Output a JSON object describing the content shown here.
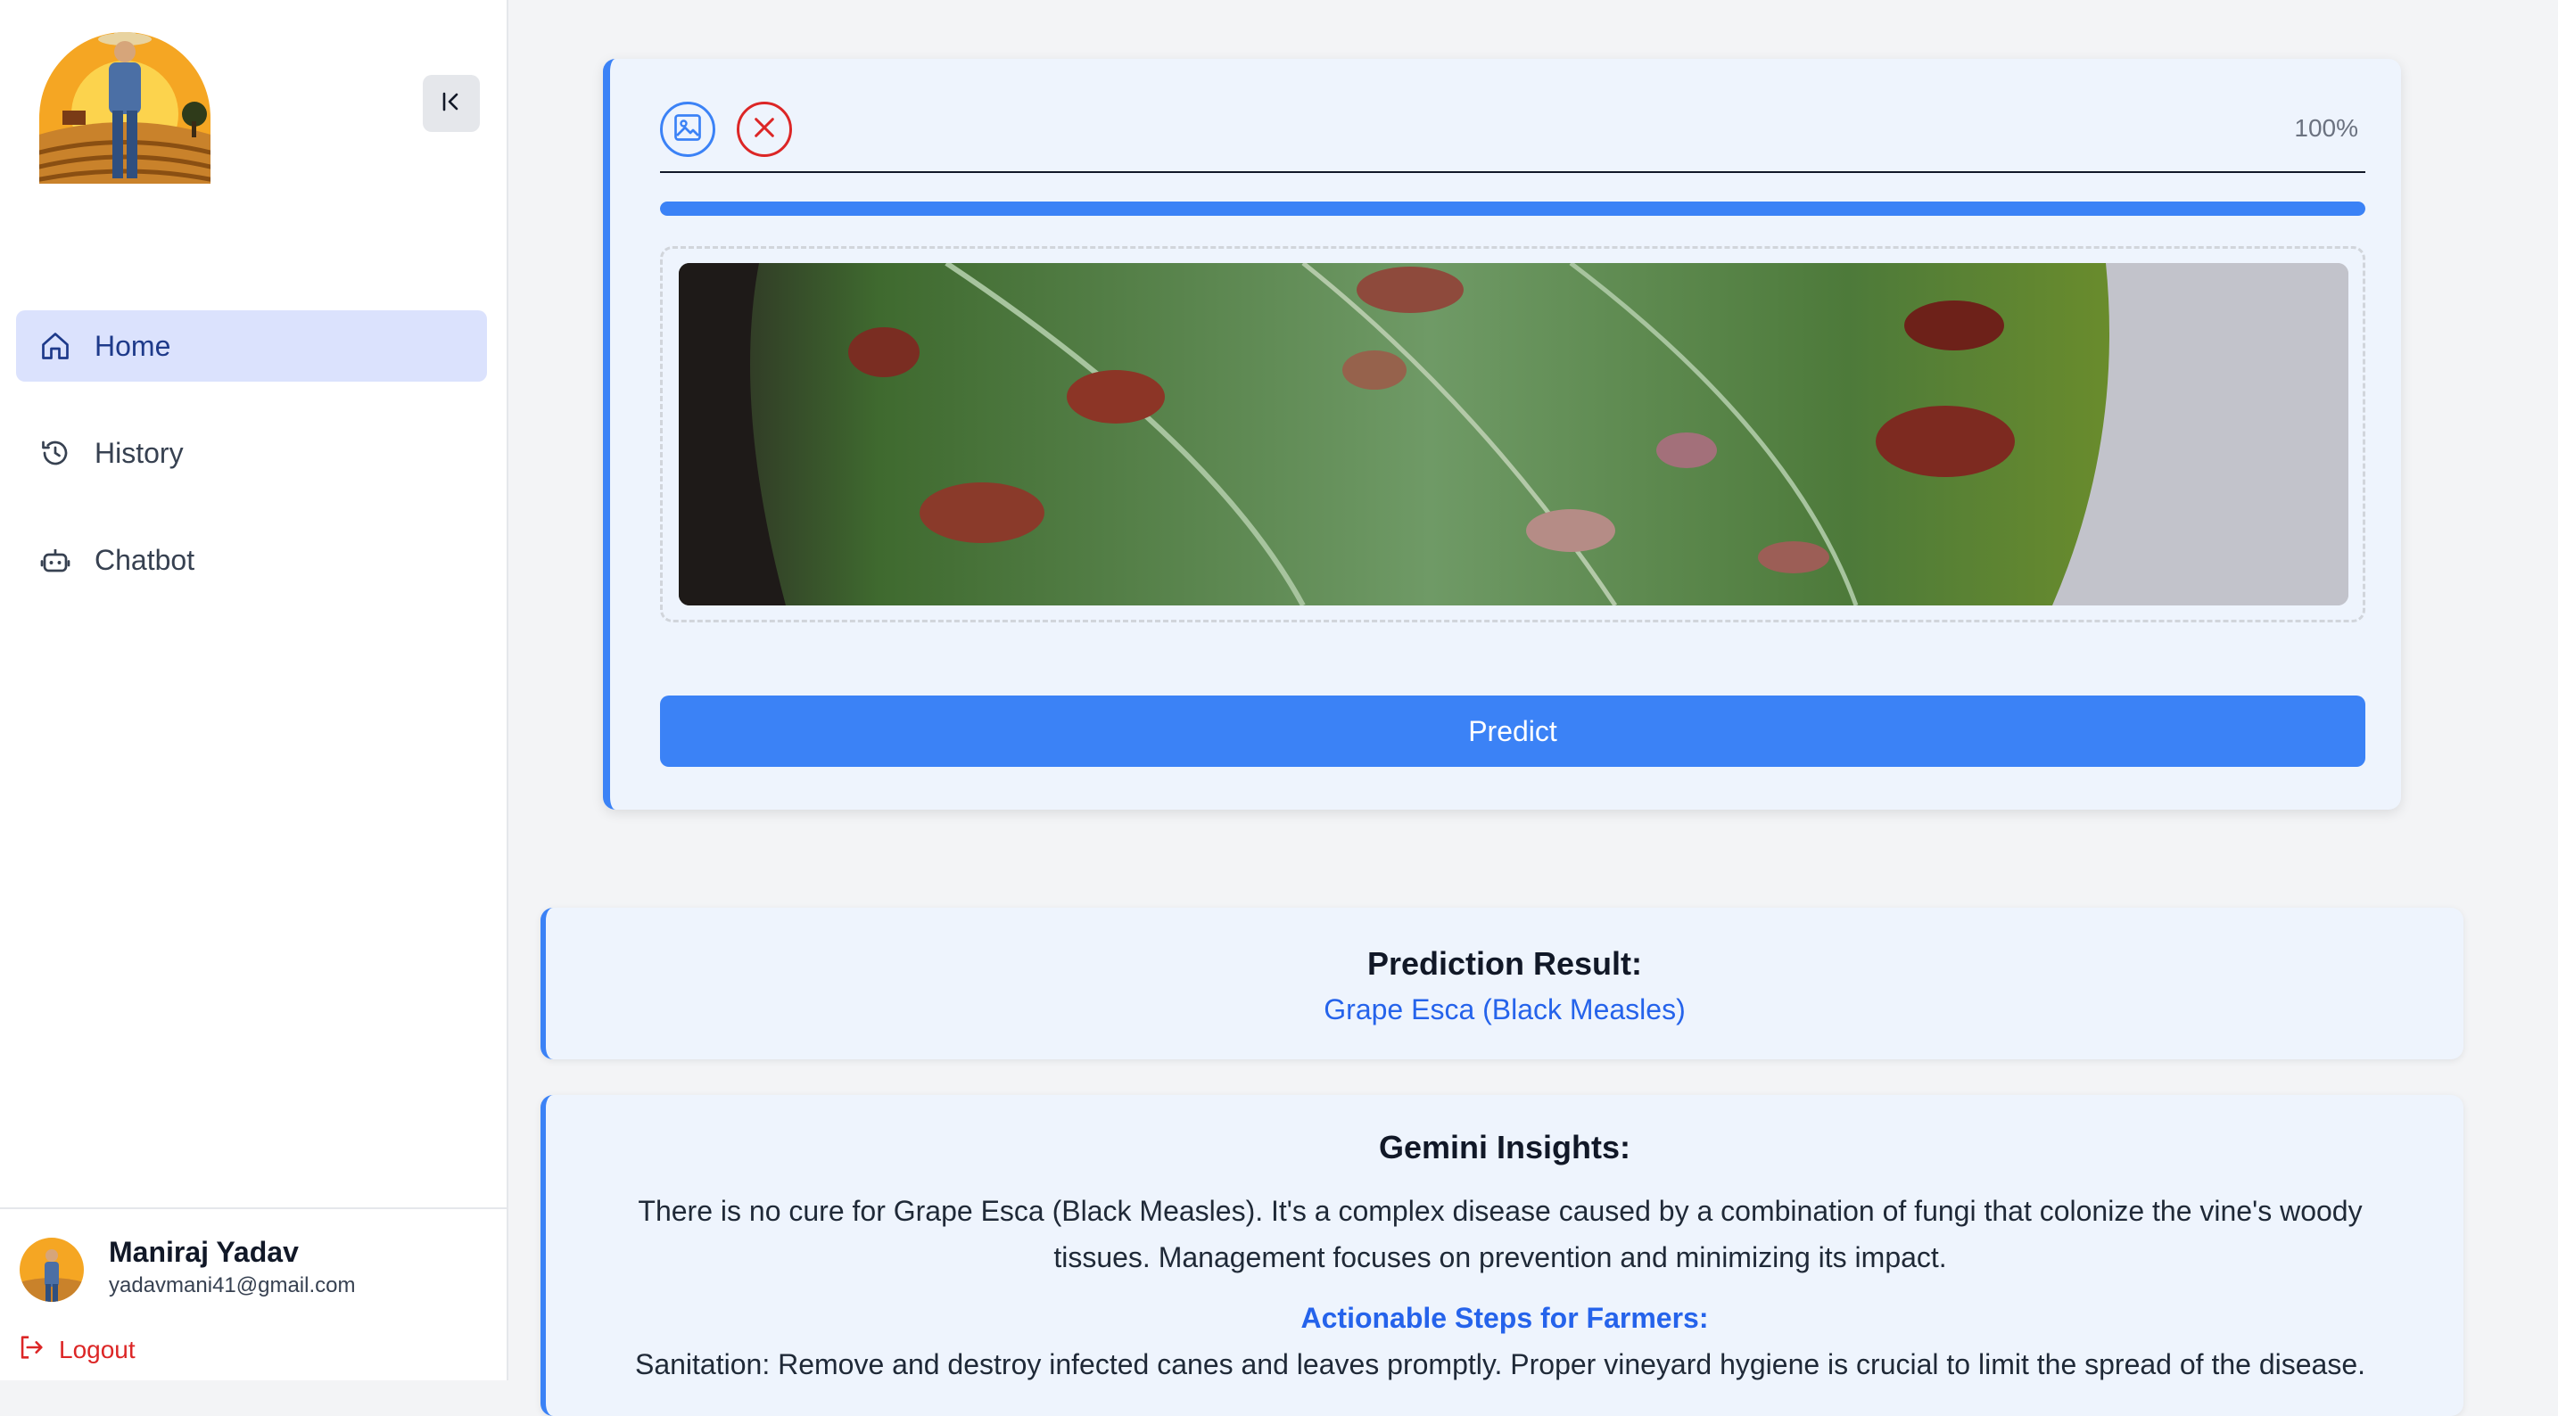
{
  "sidebar": {
    "nav": [
      {
        "label": "Home",
        "icon": "home-icon",
        "active": true
      },
      {
        "label": "History",
        "icon": "history-icon",
        "active": false
      },
      {
        "label": "Chatbot",
        "icon": "bot-icon",
        "active": false
      }
    ],
    "user": {
      "name": "Maniraj Yadav",
      "email": "yadavmani41@gmail.com"
    },
    "logout_label": "Logout"
  },
  "upload": {
    "progress_text": "100%",
    "progress_value": 1.0,
    "predict_label": "Predict"
  },
  "result": {
    "title": "Prediction Result:",
    "value": "Grape Esca (Black Measles)"
  },
  "insights": {
    "title": "Gemini Insights:",
    "body": "There is no cure for Grape Esca (Black Measles). It's a complex disease caused by a combination of fungi that colonize the vine's woody tissues. Management focuses on prevention and minimizing its impact.",
    "steps_title": "Actionable Steps for Farmers:",
    "steps_first": "Sanitation: Remove and destroy infected canes and leaves promptly. Proper vineyard hygiene is crucial to limit the spread of the disease."
  },
  "colors": {
    "accent": "#3b82f6",
    "danger": "#dc2626",
    "link": "#2563eb"
  }
}
